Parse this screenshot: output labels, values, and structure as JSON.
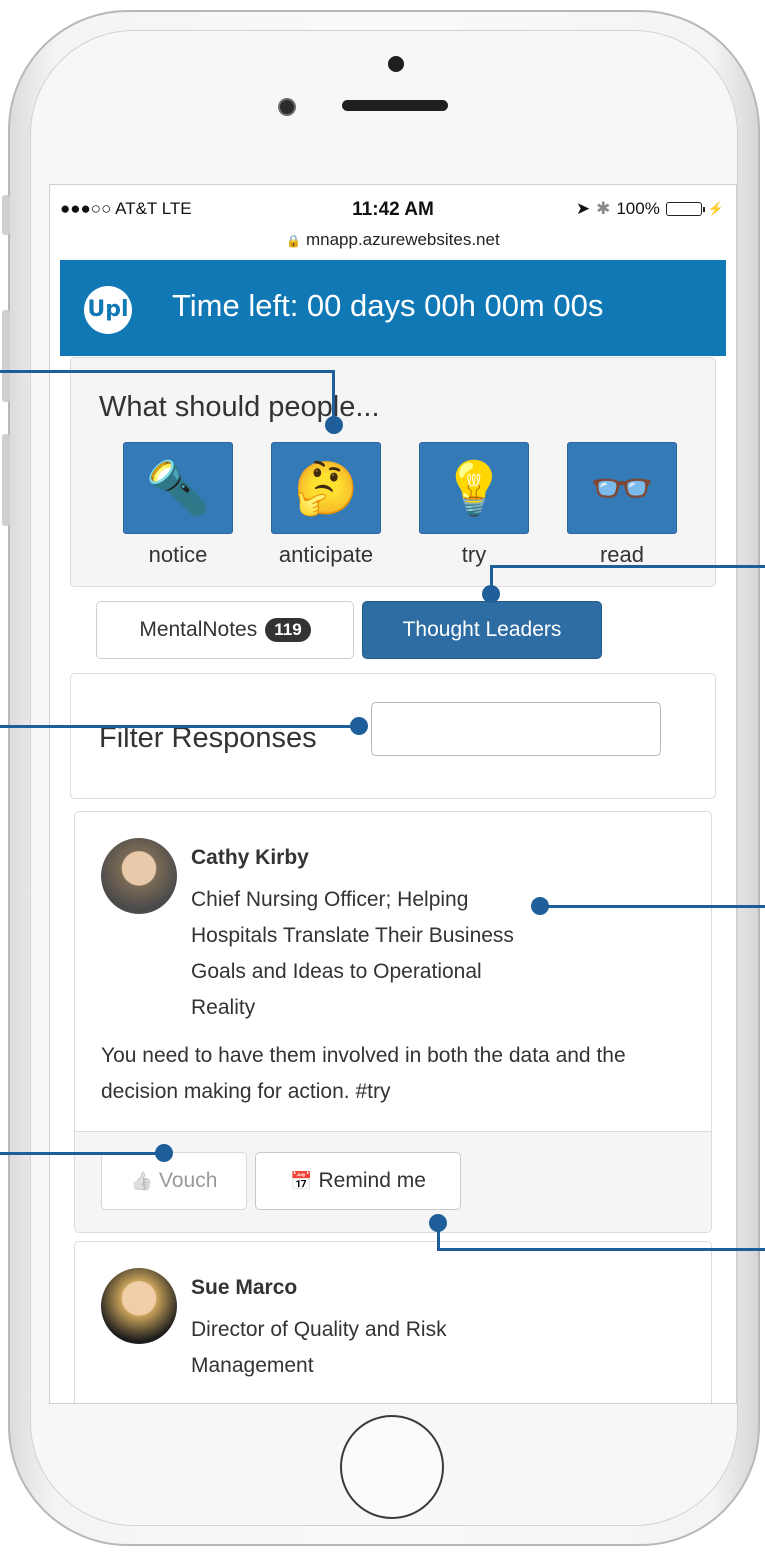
{
  "status_bar": {
    "carrier": "●●●○○ AT&T  LTE",
    "time": "11:42 AM",
    "location_icon": "➤",
    "bluetooth_icon": "✱",
    "battery": "100%",
    "charging_icon": "⚡"
  },
  "url_bar": {
    "lock_icon": "🔒",
    "url": "mnapp.azurewebsites.net"
  },
  "header": {
    "logo_text": "Upl",
    "title": "Time left: 00 days 00h 00m 00s"
  },
  "question": {
    "title": "What should people...",
    "categories": [
      {
        "label": "notice",
        "icon": "🔦"
      },
      {
        "label": "anticipate",
        "icon": "🤔"
      },
      {
        "label": "try",
        "icon": "💡"
      },
      {
        "label": "read",
        "icon": "👓"
      }
    ]
  },
  "tabs": {
    "mental_label": "MentalNotes",
    "mental_count": "119",
    "leaders_label": "Thought Leaders"
  },
  "filter": {
    "label": "Filter Responses",
    "placeholder": ""
  },
  "responses": [
    {
      "name": "Cathy Kirby",
      "role": "Chief Nursing Officer; Helping Hospitals Translate Their Business Goals and Ideas to Operational Reality",
      "comment": "You need to have them involved in both the data and the decision making for action. #try",
      "vouch_icon": "👍",
      "vouch_label": "Vouch",
      "remind_icon": "📅",
      "remind_label": "Remind me"
    },
    {
      "name": "Sue Marco",
      "role": "Director of Quality and Risk Management"
    }
  ],
  "colors": {
    "header": "#0f78b5",
    "tile": "#337ab7",
    "active_tab": "#2e6da4",
    "callout": "#1f5f99"
  }
}
